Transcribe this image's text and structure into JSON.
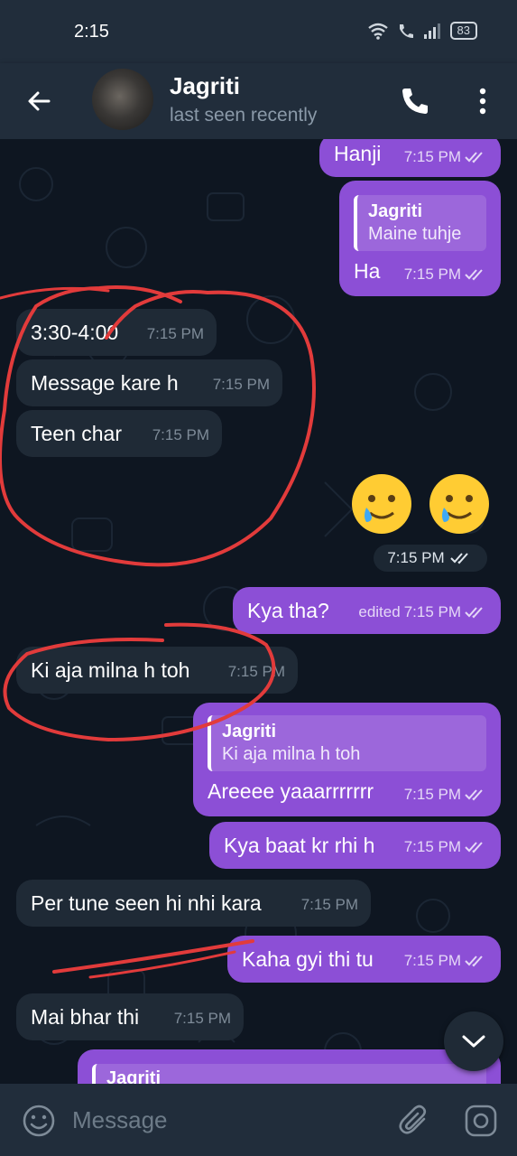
{
  "status_bar": {
    "time": "2:15",
    "battery": "83"
  },
  "header": {
    "contact_name": "Jagriti",
    "contact_status": "last seen recently",
    "icons": {
      "back": "back-arrow-icon",
      "call": "phone-icon",
      "menu": "more-vertical-icon"
    }
  },
  "messages": [
    {
      "dir": "out",
      "text": "Hanji",
      "time": "7:15 PM"
    },
    {
      "dir": "out",
      "quote": {
        "name": "Jagriti",
        "text": "Maine tuhje"
      },
      "text": "Ha",
      "time": "7:15 PM"
    },
    {
      "dir": "in",
      "text": "3:30-4:00",
      "time": "7:15 PM"
    },
    {
      "dir": "in",
      "text": "Message kare h",
      "time": "7:15 PM"
    },
    {
      "dir": "in",
      "text": "Teen char",
      "time": "7:15 PM"
    },
    {
      "dir": "out",
      "type": "emoji",
      "text": "🥲 🥲",
      "time": "7:15 PM"
    },
    {
      "dir": "out",
      "text": "Kya tha?",
      "edited": "edited",
      "time": "7:15 PM"
    },
    {
      "dir": "in",
      "text": "Ki aja milna h toh",
      "time": "7:15 PM"
    },
    {
      "dir": "out",
      "quote": {
        "name": "Jagriti",
        "text": "Ki aja milna h toh"
      },
      "text": "Areeee yaaarrrrrrr",
      "time": "7:15 PM"
    },
    {
      "dir": "out",
      "text": "Kya baat kr rhi h",
      "time": "7:15 PM"
    },
    {
      "dir": "in",
      "text": "Per tune seen hi nhi kara",
      "time": "7:15 PM"
    },
    {
      "dir": "out",
      "text": "Kaha gyi thi tu",
      "time": "7:15 PM"
    },
    {
      "dir": "in",
      "text": "Mai bhar thi",
      "time": "7:15 PM"
    },
    {
      "dir": "out",
      "quote": {
        "name": "Jagriti",
        "text": ""
      },
      "text": "",
      "time": ""
    }
  ],
  "input_bar": {
    "placeholder": "Message",
    "icons": {
      "emoji": "smiley-icon",
      "attach": "paperclip-icon",
      "camera": "camera-icon"
    }
  },
  "colors": {
    "outgoing_bubble": "#8c4fd6",
    "incoming_bubble": "#1f2a36",
    "header_bg": "#212d3b",
    "chat_bg": "#0e1621",
    "annotation_red": "#e23b3b"
  }
}
